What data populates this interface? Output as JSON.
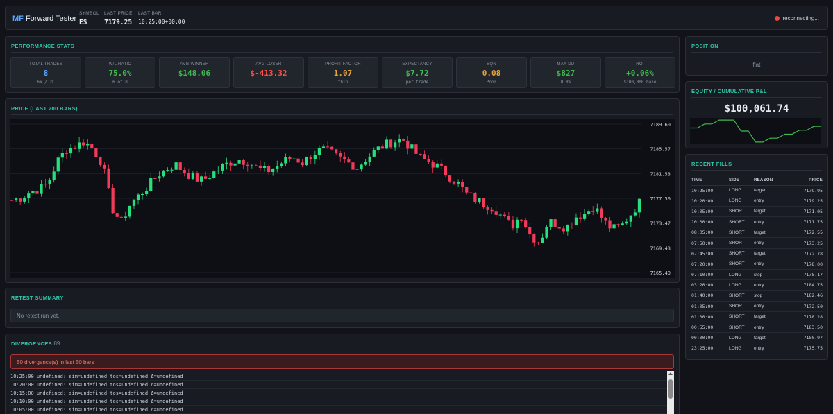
{
  "header": {
    "logo_mf": "MF",
    "logo_text": "Forward Tester",
    "symbol_label": "SYMBOL",
    "symbol": "ES",
    "last_price_label": "LAST PRICE",
    "last_price": "7179.25",
    "last_bar_label": "LAST BAR",
    "last_bar": "10:25:00+00:00",
    "status": "reconnecting..."
  },
  "performance": {
    "title": "PERFORMANCE STATS",
    "cards": [
      {
        "label": "TOTAL TRADES",
        "value": "8",
        "sub": "6W / 2L",
        "color": "#58a6ff"
      },
      {
        "label": "W/L RATIO",
        "value": "75.0%",
        "sub": "6 of 8",
        "color": "#3fb950"
      },
      {
        "label": "AVG WINNER",
        "value": "$148.06",
        "sub": "",
        "color": "#3fb950"
      },
      {
        "label": "AVG LOSER",
        "value": "$-413.32",
        "sub": "",
        "color": "#f85149"
      },
      {
        "label": "PROFIT FACTOR",
        "value": "1.07",
        "sub": "thin",
        "color": "#e3a33a"
      },
      {
        "label": "EXPECTANCY",
        "value": "$7.72",
        "sub": "per trade",
        "color": "#3fb950"
      },
      {
        "label": "SQN",
        "value": "0.08",
        "sub": "Poor",
        "color": "#e3a33a"
      },
      {
        "label": "MAX DD",
        "value": "$827",
        "sub": "0.8%",
        "color": "#3fb950"
      },
      {
        "label": "ROI",
        "value": "+0.06%",
        "sub": "$100,000 base",
        "color": "#3fb950"
      }
    ]
  },
  "price_panel": {
    "title": "PRICE (LAST 200 BARS)"
  },
  "chart_data": {
    "type": "candlestick",
    "title": "PRICE (LAST 200 BARS)",
    "ylim": [
      7164.5,
      7190.5
    ],
    "y_ticks": [
      "7189.60",
      "7185.57",
      "7181.53",
      "7177.50",
      "7173.47",
      "7169.43",
      "7165.40"
    ],
    "up_color": "#26e07f",
    "down_color": "#f23a5a",
    "close_path": [
      7177.2,
      7177.6,
      7178.5,
      7179.0,
      7180.0,
      7183.5,
      7185.5,
      7186.0,
      7186.8,
      7185.4,
      7183.0,
      7176.0,
      7173.5,
      7176.5,
      7178.0,
      7179.5,
      7181.3,
      7182.3,
      7183.0,
      7181.8,
      7180.8,
      7180.4,
      7181.5,
      7182.5,
      7183.4,
      7183.8,
      7183.4,
      7182.4,
      7181.9,
      7182.6,
      7183.7,
      7184.1,
      7183.3,
      7184.6,
      7185.5,
      7185.0,
      7184.0,
      7183.3,
      7182.6,
      7184.0,
      7185.3,
      7186.2,
      7186.8,
      7187.1,
      7185.5,
      7184.0,
      7183.4,
      7182.5,
      7181.2,
      7180.0,
      7178.2,
      7177.3,
      7176.5,
      7176.0,
      7174.3,
      7173.0,
      7174.8,
      7171.5,
      7170.3,
      7173.8,
      7173.2,
      7172.8,
      7174.5,
      7175.0,
      7176.3,
      7174.0,
      7172.5,
      7172.9,
      7174.8,
      7176.8
    ],
    "last_price": 7179.25
  },
  "retest": {
    "title": "RETEST SUMMARY",
    "message": "No retest run yet."
  },
  "divergences": {
    "title": "DIVERGENCES",
    "count": "89",
    "alert": "50 divergence(s) in last 50 bars",
    "lines": [
      "10:25:00 undefined: sim=undefined tos=undefined Δ=undefined",
      "10:20:00 undefined: sim=undefined tos=undefined Δ=undefined",
      "10:15:00 undefined: sim=undefined tos=undefined Δ=undefined",
      "10:10:00 undefined: sim=undefined tos=undefined Δ=undefined",
      "10:05:00 undefined: sim=undefined tos=undefined Δ=undefined"
    ]
  },
  "position": {
    "title": "POSITION",
    "state": "flat"
  },
  "equity": {
    "title": "EQUITY / CUMULATIVE P&L",
    "value": "$100,061.74",
    "line_color": "#3fb950",
    "curve": [
      100000,
      100000,
      100148,
      100148,
      100296,
      100296,
      100296,
      99883,
      99883,
      99470,
      99470,
      99618,
      99618,
      99766,
      99766,
      99914,
      99914,
      100062,
      100062
    ]
  },
  "fills": {
    "title": "RECENT FILLS",
    "headers": [
      "TIME",
      "SIDE",
      "REASON",
      "PRICE"
    ],
    "rows": [
      [
        "10:25:00",
        "LONG",
        "target",
        "7179.95"
      ],
      [
        "10:20:00",
        "LONG",
        "entry",
        "7179.25"
      ],
      [
        "10:05:00",
        "SHORT",
        "target",
        "7171.05"
      ],
      [
        "10:00:00",
        "SHORT",
        "entry",
        "7171.75"
      ],
      [
        "08:05:00",
        "SHORT",
        "target",
        "7172.55"
      ],
      [
        "07:50:00",
        "SHORT",
        "entry",
        "7173.25"
      ],
      [
        "07:45:00",
        "SHORT",
        "target",
        "7172.78"
      ],
      [
        "07:20:00",
        "SHORT",
        "entry",
        "7178.00"
      ],
      [
        "07:10:00",
        "LONG",
        "stop",
        "7178.17"
      ],
      [
        "03:20:00",
        "LONG",
        "entry",
        "7184.75"
      ],
      [
        "01:40:00",
        "SHORT",
        "stop",
        "7182.46"
      ],
      [
        "01:05:00",
        "SHORT",
        "entry",
        "7172.50"
      ],
      [
        "01:00:00",
        "SHORT",
        "target",
        "7178.28"
      ],
      [
        "00:55:00",
        "SHORT",
        "entry",
        "7183.50"
      ],
      [
        "00:00:00",
        "LONG",
        "target",
        "7180.97"
      ],
      [
        "23:25:00",
        "LONG",
        "entry",
        "7175.75"
      ]
    ]
  }
}
